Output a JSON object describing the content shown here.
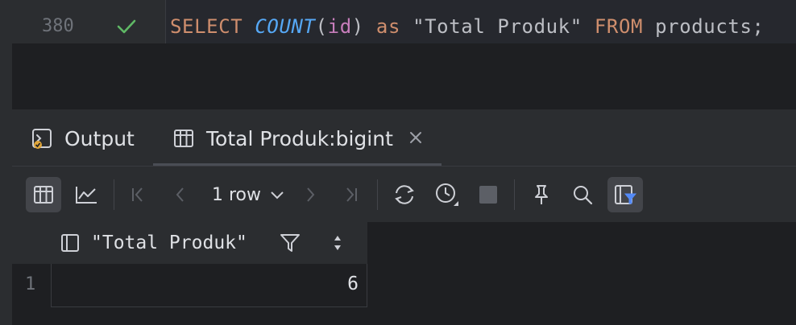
{
  "editor": {
    "line_number": "380",
    "status_icon": "check-icon",
    "code_tokens": {
      "select": "SELECT",
      "count": "COUNT",
      "open_paren": "(",
      "id": "id",
      "close_paren": ")",
      "as": "as",
      "alias": "\"Total Produk\"",
      "from": "FROM",
      "table": "products;"
    }
  },
  "tabs": [
    {
      "label": "Output",
      "icon": "console-output-icon"
    },
    {
      "label": "Total Produk:bigint",
      "icon": "table-icon",
      "closable": true
    }
  ],
  "toolbar": {
    "rows_label": "1 row",
    "buttons": [
      "table-view-icon",
      "chart-view-icon",
      "first-page-icon",
      "previous-page-icon",
      "next-page-icon",
      "last-page-icon",
      "reload-icon",
      "history-icon",
      "stop-icon",
      "pin-icon",
      "search-icon",
      "filter-view-icon"
    ]
  },
  "grid": {
    "columns": [
      "\"Total Produk\""
    ],
    "rows": [
      {
        "row_number": "1",
        "values": [
          "6"
        ]
      }
    ]
  },
  "colors": {
    "background": "#1e1f22",
    "panel": "#2b2d30",
    "keyword": "#cf8e6d",
    "function": "#56a8f5",
    "identifier": "#c77dbb",
    "success": "#5fb865",
    "filter_accent": "#548af7"
  }
}
